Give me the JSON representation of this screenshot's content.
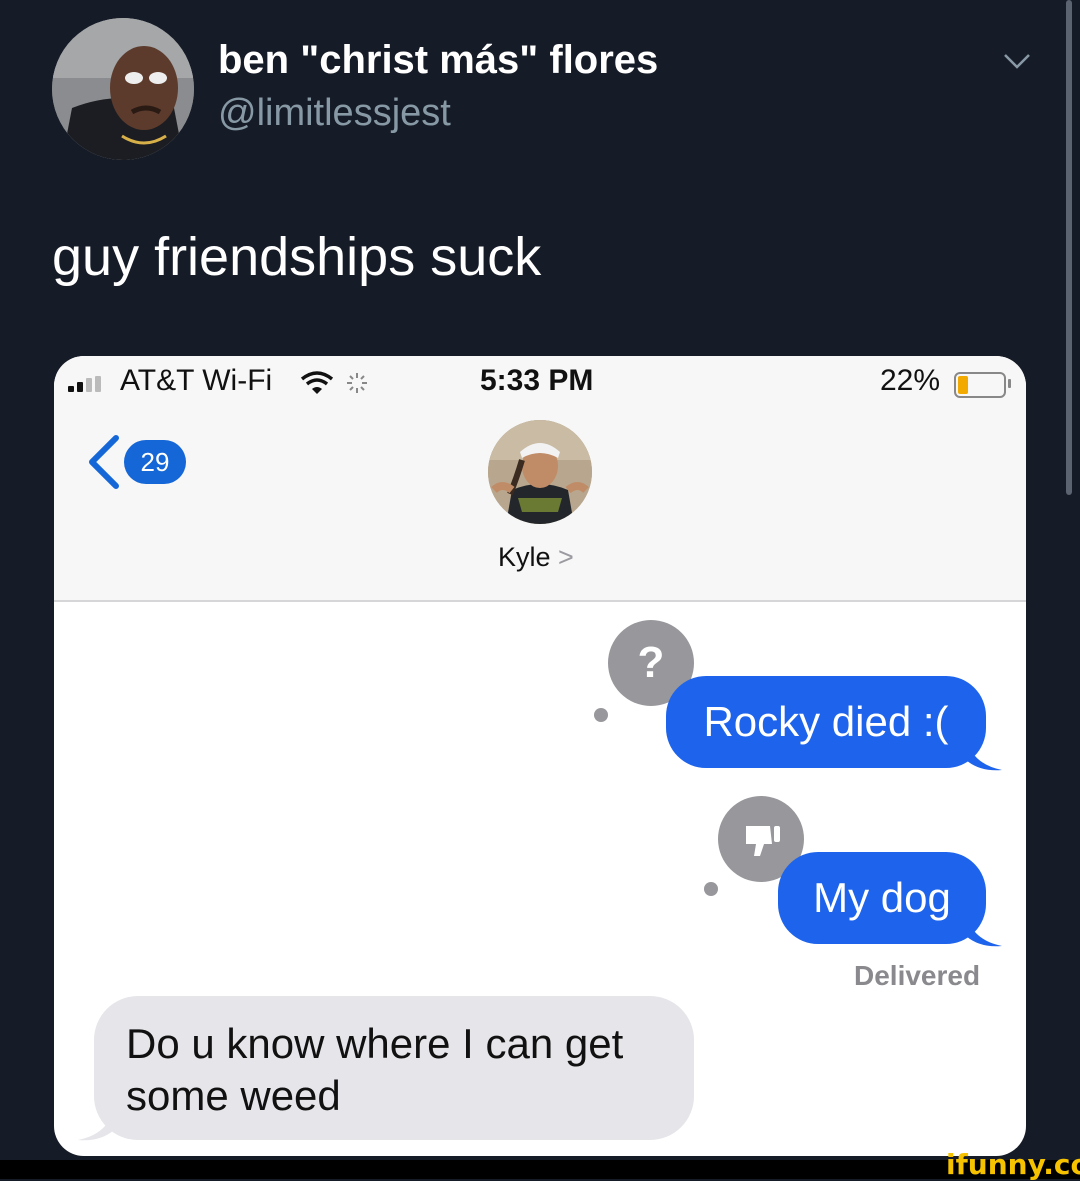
{
  "tweet": {
    "display_name": "ben \"christ más\" flores",
    "handle": "@limitlessjest",
    "text": "guy friendships suck"
  },
  "status_bar": {
    "carrier": "AT&T Wi-Fi",
    "time": "5:33 PM",
    "battery": "22%",
    "battery_level": 0.22
  },
  "header": {
    "unread_count": "29",
    "contact_name": "Kyle",
    "contact_chevron": ">"
  },
  "messages": [
    {
      "direction": "outgoing",
      "text": "Rocky died :(",
      "tapback": "?"
    },
    {
      "direction": "outgoing",
      "text": "My dog",
      "tapback": "thumbs-down"
    },
    {
      "direction": "incoming",
      "text": "Do u know where I can get some weed"
    }
  ],
  "delivered_label": "Delivered",
  "watermark": "ifunny.co",
  "colors": {
    "background": "#161c27",
    "imessage_blue": "#1d63eb",
    "incoming_gray": "#e5e5ea",
    "badge_blue": "#1566d6"
  }
}
